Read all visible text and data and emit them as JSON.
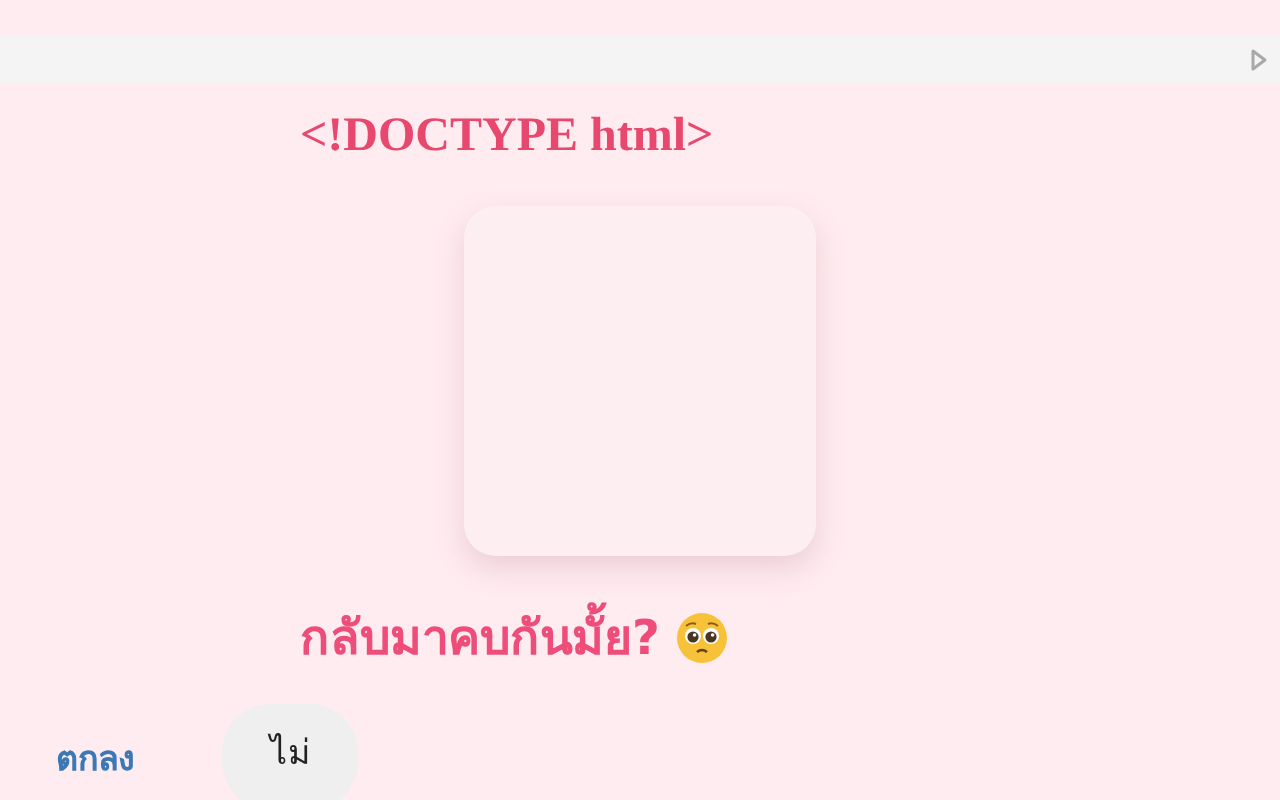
{
  "toolbar": {
    "run_icon": true
  },
  "heading": "<!DOCTYPE html>",
  "question": {
    "text": "กลับมาคบกันมั้ย?",
    "emoji": true
  },
  "buttons": [
    {
      "label": "ตกลง",
      "kind": "link"
    },
    {
      "label": "ไม่",
      "kind": "pill"
    }
  ]
}
